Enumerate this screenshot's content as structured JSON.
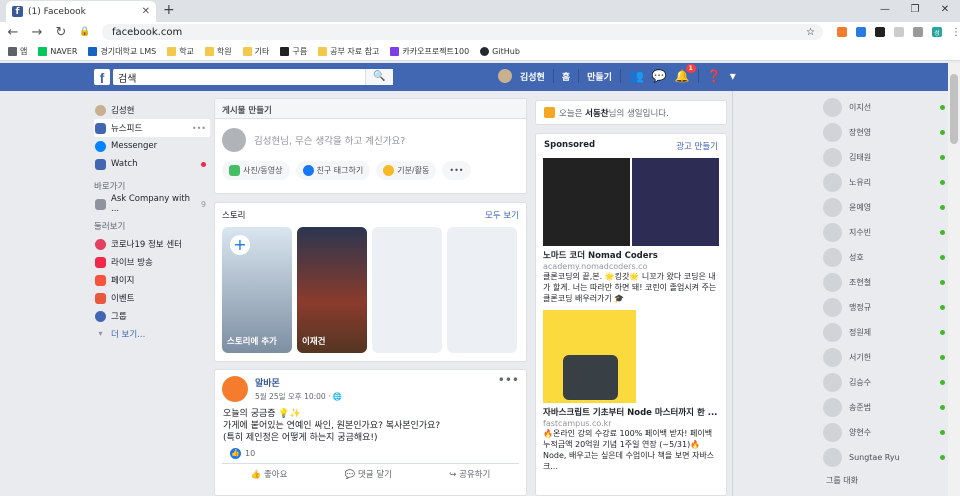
{
  "browser": {
    "tab_title": "(1) Facebook",
    "url": "facebook.com",
    "profile_initial": "성현",
    "bookmarks": [
      "앱",
      "NAVER",
      "경기대학교 LMS",
      "학교",
      "학원",
      "기타",
      "구름",
      "공부 자료 참고",
      "카카오프로젝트100",
      "GitHub"
    ]
  },
  "fb_header": {
    "logo": "f",
    "search_placeholder": "검색",
    "user_name": "김성현",
    "home": "홈",
    "create": "만들기",
    "notif_count": "1"
  },
  "left_nav": {
    "profile": "김성현",
    "news_feed": "뉴스피드",
    "messenger": "Messenger",
    "watch": "Watch",
    "shortcuts_title": "바로가기",
    "shortcut_1": "Ask Company with ...",
    "shortcut_1_count": "9",
    "explore_title": "둘러보기",
    "explore": [
      "코로나19 정보 센터",
      "라이브 방송",
      "페이지",
      "이벤트",
      "그룹"
    ],
    "see_more": "더 보기..."
  },
  "composer": {
    "title": "게시물 만들기",
    "placeholder": "김성현님, 무슨 생각을 하고 계신가요?",
    "photo_video": "사진/동영상",
    "tag_friends": "친구 태그하기",
    "feeling": "기분/활동"
  },
  "stories": {
    "title": "스토리",
    "see_all": "모두 보기",
    "add_story": "스토리에 추가",
    "story_2": "이재건"
  },
  "post": {
    "author": "알바몬",
    "meta": "5월 25일 오후 10:00 · ",
    "line1": "오늘의 궁금증 💡✨",
    "line2": "가게에 붙어있는 연예인 싸인, 원본인가요? 복사본인가요?",
    "line3": "(특히 제인정은 어떻게 하는지 궁금해요!)",
    "likes": "10",
    "like": "좋아요",
    "comment": "댓글 달기",
    "share": "공유하기"
  },
  "birthday": {
    "prefix": "오늘은 ",
    "name": "서동찬",
    "suffix": "님의 생일입니다."
  },
  "ads": {
    "sponsored": "Sponsored",
    "create_ad": "광고 만들기",
    "ad1_title": "노마드 코더 Nomad Coders",
    "ad1_url": "academy.nomadcoders.co",
    "ad1_desc": "클론코딩의 끝,본. 🌟킹갓🌟 니꼬가 왔다 코딩은 내가 할게. 너는 따라만 하면 돼! 코린이 졸업시켜 주는 클론코딩 배우러가기 🎓",
    "ad2_title": "자바스크립트 기초부터 Node 마스터까지 한 ...",
    "ad2_url": "fastcampus.co.kr",
    "ad2_desc": "🔥온라인 강의 수강료 100% 페이백 받자! 페이백 누적금액 20억원 기념 1주일 연장 (~5/31)🔥 Node, 배우고는 싶은데 수업이나 책을 보면 자바스크..."
  },
  "contacts": {
    "names": [
      "이지선",
      "장현영",
      "김태원",
      "노유리",
      "윤예영",
      "지수빈",
      "성호",
      "조현철",
      "맹정규",
      "정원제",
      "서기헌",
      "김승수",
      "송준범",
      "양현수",
      "Sungtae Ryu"
    ],
    "group_title": "그룹 대화"
  }
}
